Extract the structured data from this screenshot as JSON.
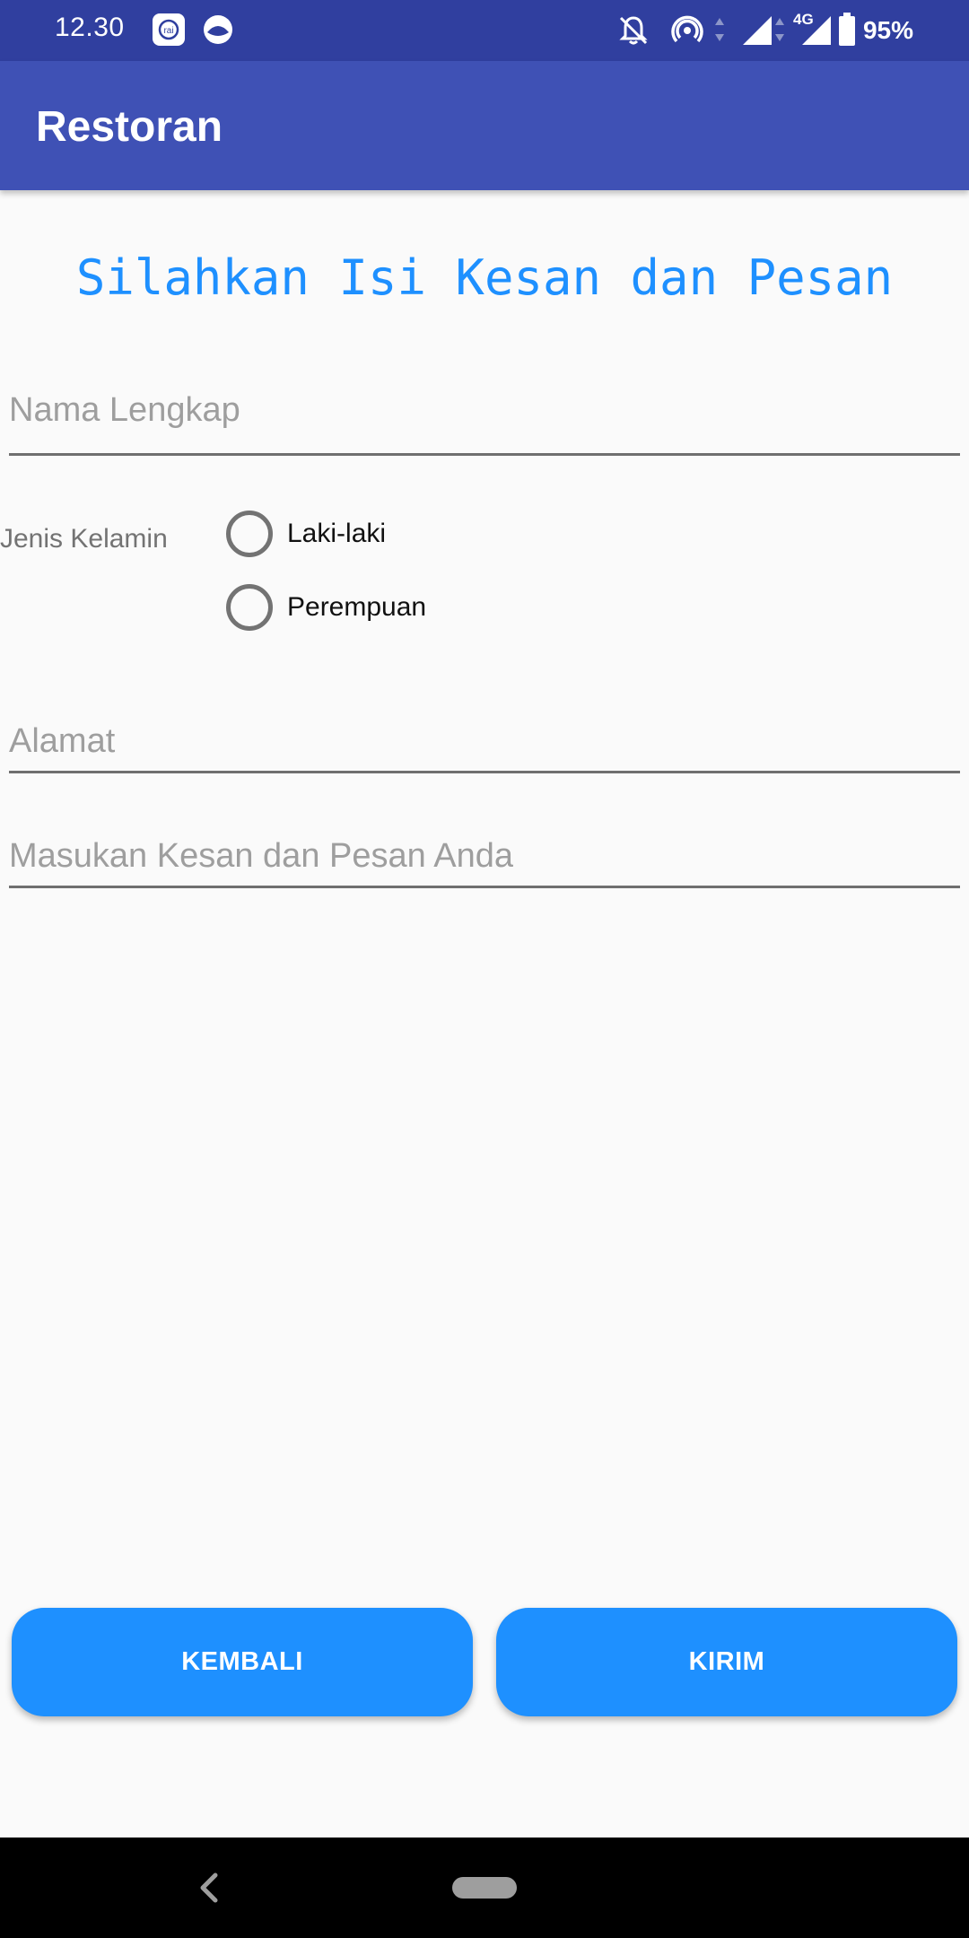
{
  "status_bar": {
    "time": "12.30",
    "battery": "95%",
    "network": "4G",
    "icons": [
      "app-notification-icon",
      "app-notification-icon-2",
      "bell-off-icon",
      "hotspot-icon",
      "signal-icon",
      "signal-4g-icon",
      "battery-icon"
    ]
  },
  "app_bar": {
    "title": "Restoran"
  },
  "form": {
    "heading": "Silahkan Isi Kesan dan Pesan",
    "name_placeholder": "Nama Lengkap",
    "gender_label": "Jenis Kelamin",
    "gender_options": [
      "Laki-laki",
      "Perempuan"
    ],
    "address_placeholder": "Alamat",
    "message_placeholder": "Masukan Kesan dan Pesan Anda"
  },
  "buttons": {
    "back_label": "KEMBALI",
    "send_label": "KIRIM"
  },
  "colors": {
    "status_bar": "#303f9f",
    "app_bar": "#3f51b5",
    "accent": "#1e90ff"
  }
}
